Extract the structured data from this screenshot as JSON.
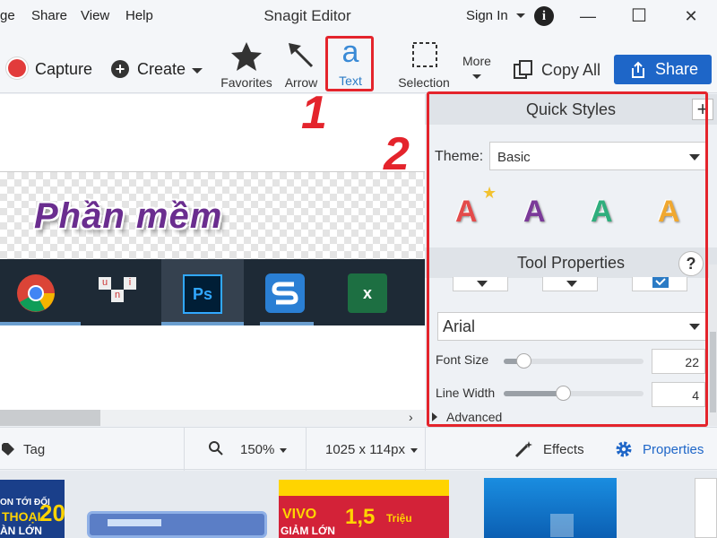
{
  "titlebar": {
    "menus": [
      "ge",
      "Share",
      "View",
      "Help"
    ],
    "app_title": "Snagit Editor",
    "sign_in": "Sign In",
    "info_glyph": "i",
    "minimize_glyph": "—",
    "maximize_glyph": "☐",
    "close_glyph": "✕"
  },
  "toolbar": {
    "capture_label": "Capture",
    "create_label": "Create",
    "create_glyph": "+",
    "tools": [
      {
        "label": "Favorites",
        "icon": "star-icon"
      },
      {
        "label": "Arrow",
        "icon": "arrow-icon"
      },
      {
        "label": "Text",
        "icon": "text-icon",
        "glyph": "a"
      },
      {
        "label": "Selection",
        "icon": "selection-icon"
      }
    ],
    "more_label": "More",
    "copy_all_label": "Copy All",
    "share_label": "Share",
    "share_color": "#1e66c8"
  },
  "canvas": {
    "image_text": "Phần mềm",
    "taskbar_apps": [
      "chrome-icon",
      "unikey-icon",
      "photoshop-icon",
      "snagit-icon",
      "excel-icon"
    ],
    "ps_label": "Ps",
    "excel_label": "x",
    "unikey_letters": [
      "u",
      "n",
      "i"
    ],
    "scroll_arrow": "›"
  },
  "annotations": {
    "one": "1",
    "two": "2",
    "color": "#e4242c"
  },
  "quick_styles": {
    "header": "Quick Styles",
    "add_glyph": "+",
    "theme_label": "Theme:",
    "theme_value": "Basic",
    "styles": [
      {
        "glyph": "A",
        "color": "#e34b4b"
      },
      {
        "glyph": "A",
        "color": "#7b3a99"
      },
      {
        "glyph": "A",
        "color": "#2fae7d"
      },
      {
        "glyph": "A",
        "color": "#f0a830"
      }
    ],
    "favorite_glyph": "★"
  },
  "tool_properties": {
    "header": "Tool Properties",
    "help_glyph": "?",
    "font_value": "Arial",
    "font_size_label": "Font Size",
    "font_size_value": "22",
    "font_size_fraction": 0.14,
    "line_width_label": "Line Width",
    "line_width_value": "4",
    "line_width_fraction": 0.42,
    "advanced_label": "Advanced"
  },
  "statusbar": {
    "tag_label": "Tag",
    "zoom_value": "150%",
    "dimensions": "1025 x 114px",
    "effects_label": "Effects",
    "properties_label": "Properties"
  },
  "tray": {
    "thumb1_lines": [
      "ON TỚI ĐỐI",
      "THOẠI",
      "ÀN LỚN"
    ],
    "thumb1_num": "20",
    "thumb3_lines": [
      "VIVO",
      "GIẢM LỚN"
    ],
    "thumb3_price": "1,5",
    "thumb3_unit": "Triệu"
  }
}
